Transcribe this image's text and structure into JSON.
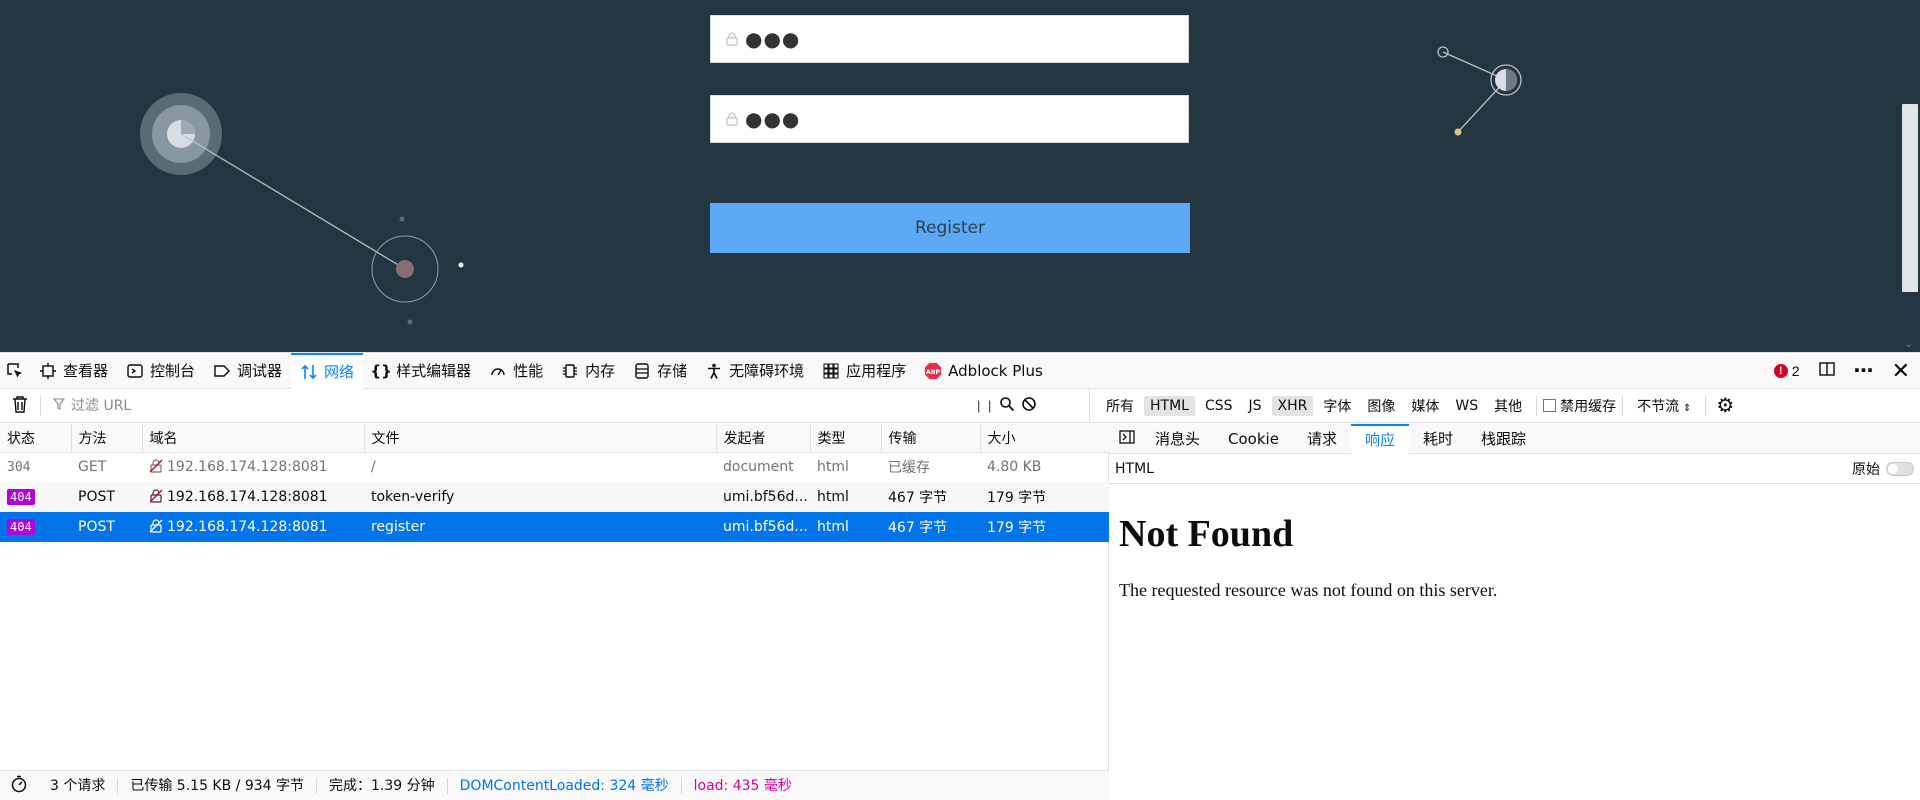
{
  "page": {
    "password_mask_1": "●●●",
    "password_mask_2": "●●●",
    "register_label": "Register"
  },
  "devtools": {
    "tabs": [
      {
        "label": "查看器",
        "icon": "inspector-icon"
      },
      {
        "label": "控制台",
        "icon": "console-icon"
      },
      {
        "label": "调试器",
        "icon": "debugger-icon"
      },
      {
        "label": "网络",
        "icon": "network-icon",
        "active": true
      },
      {
        "label": "样式编辑器",
        "icon": "style-editor-icon"
      },
      {
        "label": "性能",
        "icon": "performance-icon"
      },
      {
        "label": "内存",
        "icon": "memory-icon"
      },
      {
        "label": "存储",
        "icon": "storage-icon"
      },
      {
        "label": "无障碍环境",
        "icon": "accessibility-icon"
      },
      {
        "label": "应用程序",
        "icon": "application-icon"
      },
      {
        "label": "Adblock Plus",
        "icon": "adblock-icon"
      }
    ],
    "error_count": "2",
    "toolbar": {
      "filter_placeholder": "过滤 URL",
      "types": [
        "所有",
        "HTML",
        "CSS",
        "JS",
        "XHR",
        "字体",
        "图像",
        "媒体",
        "WS",
        "其他"
      ],
      "disable_cache": "禁用缓存",
      "throttling": "不节流"
    },
    "columns": [
      "状态",
      "方法",
      "域名",
      "文件",
      "发起者",
      "类型",
      "传输",
      "大小"
    ],
    "requests": [
      {
        "status": "304",
        "method": "GET",
        "domain": "192.168.174.128:8081",
        "file": "/",
        "initiator": "document",
        "type": "html",
        "transferred": "已缓存",
        "size": "4.80 KB"
      },
      {
        "status": "404",
        "method": "POST",
        "domain": "192.168.174.128:8081",
        "file": "token-verify",
        "initiator": "umi.bf56d...",
        "type": "html",
        "transferred": "467 字节",
        "size": "179 字节"
      },
      {
        "status": "404",
        "method": "POST",
        "domain": "192.168.174.128:8081",
        "file": "register",
        "initiator": "umi.bf56d...",
        "type": "html",
        "transferred": "467 字节",
        "size": "179 字节"
      }
    ],
    "summary": {
      "requests": "3 个请求",
      "transferred": "已传输 5.15 KB / 934 字节",
      "finish": "完成：1.39 分钟",
      "dom_loaded": "DOMContentLoaded: 324 毫秒",
      "load": "load: 435 毫秒"
    },
    "detail": {
      "tabs": [
        "消息头",
        "Cookie",
        "请求",
        "响应",
        "耗时",
        "栈跟踪"
      ],
      "active_tab": "响应",
      "format": "HTML",
      "raw_label": "原始",
      "response_title": "Not Found",
      "response_text": "The requested resource was not found on this server."
    }
  }
}
